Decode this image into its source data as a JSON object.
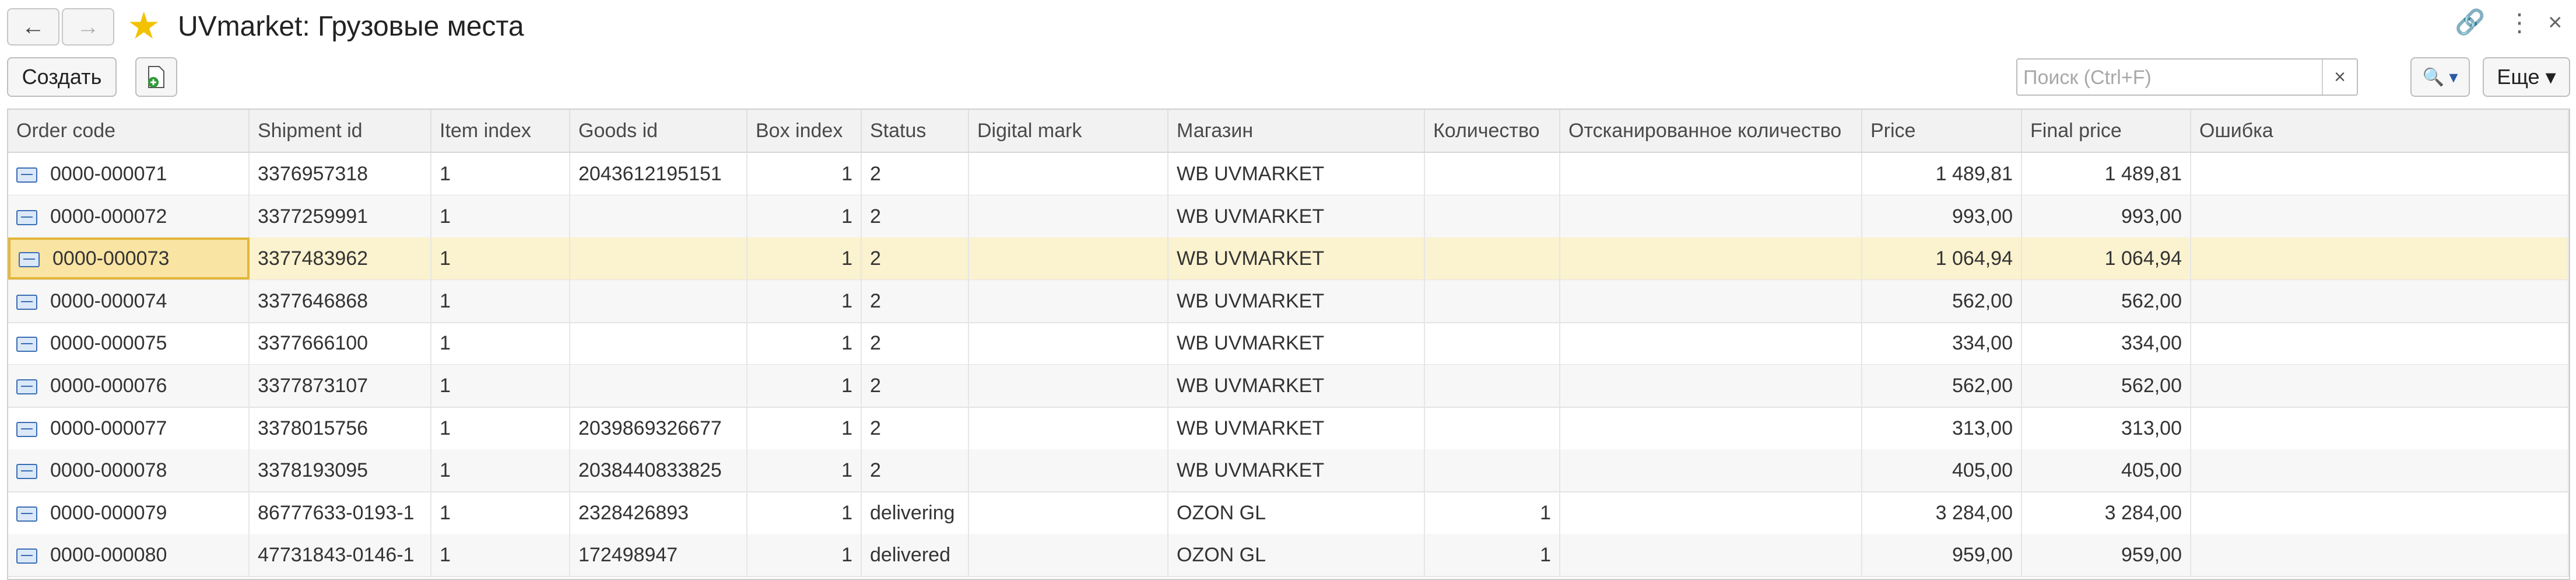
{
  "window": {
    "title": "UVmarket: Грузовые места"
  },
  "nav": {
    "back": "←",
    "forward": "→"
  },
  "toolbar": {
    "create_label": "Создать",
    "search_placeholder": "Поиск (Ctrl+F)",
    "search_value": "",
    "clear": "×",
    "search_btn": "🔍 ▾",
    "more_label": "Еще ▾"
  },
  "table": {
    "columns": [
      "Order code",
      "Shipment id",
      "Item index",
      "Goods id",
      "Box index",
      "Status",
      "Digital mark",
      "Магазин",
      "Количество",
      "Отсканированное количество",
      "Price",
      "Final price",
      "Ошибка"
    ],
    "rows": [
      [
        "0000-000071",
        "3376957318",
        "1",
        "2043612195151",
        "1",
        "2",
        "",
        "WB UVMARKET",
        "",
        "",
        "1 489,81",
        "1 489,81",
        ""
      ],
      [
        "0000-000072",
        "3377259991",
        "1",
        "",
        "1",
        "2",
        "",
        "WB UVMARKET",
        "",
        "",
        "993,00",
        "993,00",
        ""
      ],
      [
        "0000-000073",
        "3377483962",
        "1",
        "",
        "1",
        "2",
        "",
        "WB UVMARKET",
        "",
        "",
        "1 064,94",
        "1 064,94",
        ""
      ],
      [
        "0000-000074",
        "3377646868",
        "1",
        "",
        "1",
        "2",
        "",
        "WB UVMARKET",
        "",
        "",
        "562,00",
        "562,00",
        ""
      ],
      [
        "0000-000075",
        "3377666100",
        "1",
        "",
        "1",
        "2",
        "",
        "WB UVMARKET",
        "",
        "",
        "334,00",
        "334,00",
        ""
      ],
      [
        "0000-000076",
        "3377873107",
        "1",
        "",
        "1",
        "2",
        "",
        "WB UVMARKET",
        "",
        "",
        "562,00",
        "562,00",
        ""
      ],
      [
        "0000-000077",
        "3378015756",
        "1",
        "2039869326677",
        "1",
        "2",
        "",
        "WB UVMARKET",
        "",
        "",
        "313,00",
        "313,00",
        ""
      ],
      [
        "0000-000078",
        "3378193095",
        "1",
        "2038440833825",
        "1",
        "2",
        "",
        "WB UVMARKET",
        "",
        "",
        "405,00",
        "405,00",
        ""
      ],
      [
        "0000-000079",
        "86777633-0193-1",
        "1",
        "2328426893",
        "1",
        "delivering",
        "",
        "OZON GL",
        "1",
        "",
        "3 284,00",
        "3 284,00",
        ""
      ],
      [
        "0000-000080",
        "47731843-0146-1",
        "1",
        "172498947",
        "1",
        "delivered",
        "",
        "OZON GL",
        "1",
        "",
        "959,00",
        "959,00",
        ""
      ]
    ]
  }
}
